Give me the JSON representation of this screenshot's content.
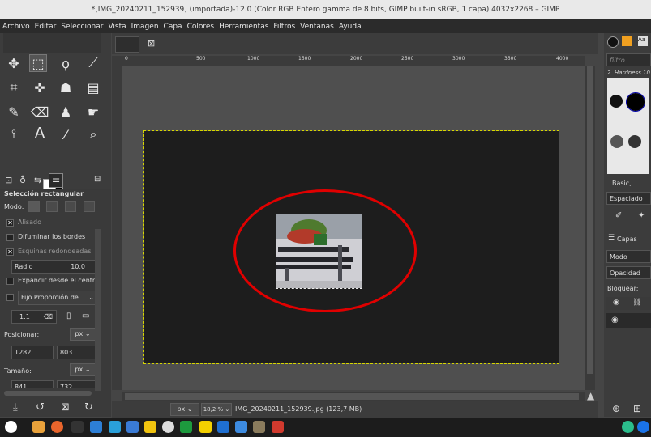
{
  "window": {
    "title": "*[IMG_20240211_152939] (importada)-12.0 (Color RGB Entero gamma de 8 bits, GIMP built-in sRGB, 1 capa) 4032x2268 – GIMP"
  },
  "menu": [
    "Archivo",
    "Editar",
    "Seleccionar",
    "Vista",
    "Imagen",
    "Capa",
    "Colores",
    "Herramientas",
    "Filtros",
    "Ventanas",
    "Ayuda"
  ],
  "tool_options": {
    "title": "Selección rectangular",
    "mode_label": "Modo:",
    "antialias_label": "Alisado",
    "feather_label": "Difuminar los bordes",
    "rounded_label": "Esquinas redondeadas",
    "radius_label": "Radio",
    "radius_value": "10,0",
    "expand_label": "Expandir desde el centro",
    "fixed_label": "Fijo",
    "fixed_value": "Proporción de...",
    "ratio_value": "1:1",
    "position_label": "Posicionar:",
    "position_unit": "px",
    "pos_x": "1282",
    "pos_y": "803",
    "size_label": "Tamaño:",
    "size_unit": "px",
    "size_w": "841",
    "size_h": "732"
  },
  "rulers": [
    "0",
    "500",
    "1000",
    "1500",
    "2000",
    "2500",
    "3000",
    "3500",
    "4000"
  ],
  "status": {
    "unit": "px",
    "zoom": "18,2 %",
    "file": "IMG_20240211_152939.jpg (123,7 MB)"
  },
  "right_dock": {
    "filter_placeholder": "filtro",
    "brush_name": "2. Hardness 10",
    "brush_set": "Basic,",
    "spacing_label": "Espaciado",
    "layers_tab": "Capas",
    "mode_label": "Modo",
    "opacity_label": "Opacidad",
    "lock_label": "Bloquear:"
  }
}
